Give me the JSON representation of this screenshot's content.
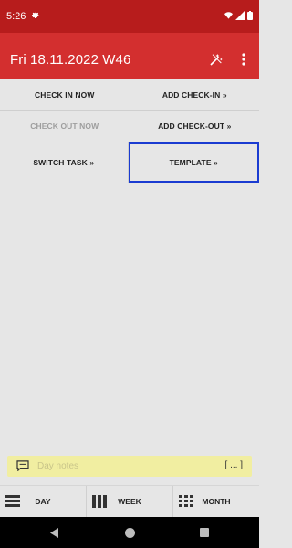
{
  "status": {
    "time": "5:26",
    "colors": {
      "bar": "#b71c1c",
      "appbar": "#d32f2f"
    }
  },
  "appbar": {
    "title": "Fri 18.11.2022 W46",
    "icons": [
      "magic-wand-icon",
      "more-vert-icon"
    ]
  },
  "actions": {
    "check_in_now": "CHECK IN NOW",
    "add_check_in": "ADD CHECK-IN »",
    "check_out_now": "CHECK OUT NOW",
    "add_check_out": "ADD CHECK-OUT »",
    "switch_task": "SWITCH TASK »",
    "template": "TEMPLATE »"
  },
  "notes": {
    "placeholder": "Day notes",
    "more_label": "[ ... ]"
  },
  "bottom_nav": {
    "day": "DAY",
    "week": "WEEK",
    "month": "MONTH"
  }
}
